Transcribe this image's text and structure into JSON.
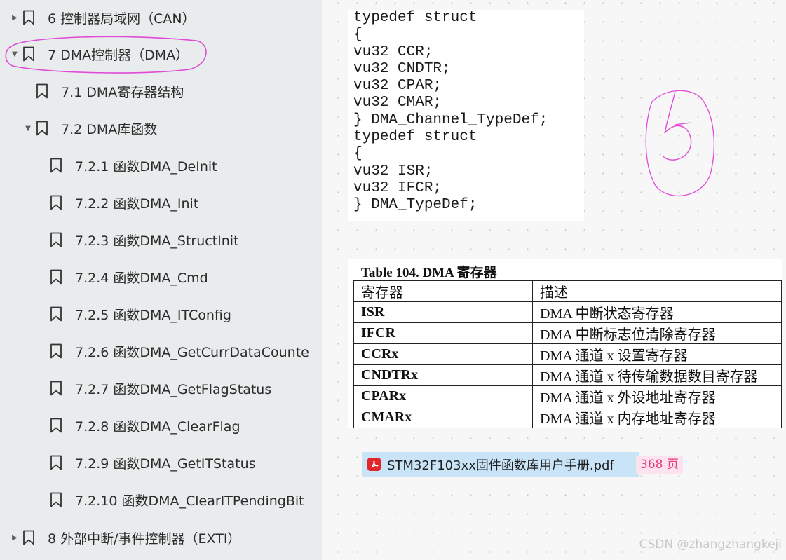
{
  "sidebar": {
    "items": [
      {
        "label": "6 控制器局域网（CAN）",
        "toggle": "collapsed"
      },
      {
        "label": "7  DMA控制器（DMA）",
        "toggle": "expanded"
      },
      {
        "label": "7.1 DMA寄存器结构",
        "toggle": "none"
      },
      {
        "label": "7.2 DMA库函数",
        "toggle": "expanded"
      },
      {
        "label": "7.2.1 函数DMA_DeInit",
        "toggle": "none"
      },
      {
        "label": "7.2.2 函数DMA_Init",
        "toggle": "none"
      },
      {
        "label": "7.2.3 函数DMA_StructInit",
        "toggle": "none"
      },
      {
        "label": "7.2.4 函数DMA_Cmd",
        "toggle": "none"
      },
      {
        "label": "7.2.5 函数DMA_ITConfig",
        "toggle": "none"
      },
      {
        "label": "7.2.6 函数DMA_GetCurrDataCounte",
        "toggle": "none"
      },
      {
        "label": "7.2.7 函数DMA_GetFlagStatus",
        "toggle": "none"
      },
      {
        "label": "7.2.8 函数DMA_ClearFlag",
        "toggle": "none"
      },
      {
        "label": "7.2.9 函数DMA_GetITStatus",
        "toggle": "none"
      },
      {
        "label": "7.2.10 函数DMA_ClearITPendingBit",
        "toggle": "none"
      },
      {
        "label": "8 外部中断/事件控制器（EXTI）",
        "toggle": "collapsed"
      }
    ],
    "bookmark_icon": "bookmark-icon",
    "highlight_color": "#e04ad6"
  },
  "code": {
    "lines": [
      "typedef struct",
      "{",
      "vu32 CCR;",
      "vu32 CNDTR;",
      "vu32 CPAR;",
      "vu32 CMAR;",
      "} DMA_Channel_TypeDef;",
      "typedef struct",
      "{",
      "vu32 ISR;",
      "vu32 IFCR;",
      "} DMA_TypeDef;"
    ]
  },
  "register_table": {
    "title": "Table 104. DMA 寄存器",
    "headers": [
      "寄存器",
      "描述"
    ],
    "rows": [
      [
        "ISR",
        "DMA 中断状态寄存器"
      ],
      [
        "IFCR",
        "DMA 中断标志位清除寄存器"
      ],
      [
        "CCRx",
        "DMA 通道 x 设置寄存器"
      ],
      [
        "CNDTRx",
        "DMA 通道 x 待传输数据数目寄存器"
      ],
      [
        "CPARx",
        "DMA 通道 x 外设地址寄存器"
      ],
      [
        "CMARx",
        "DMA 通道 x 内存地址寄存器"
      ]
    ]
  },
  "pdf_ref": {
    "file_name": "STM32F103xx固件函数库用户手册.pdf",
    "page": "368 页",
    "icon": "pdf-file-icon"
  },
  "annotation": {
    "handwritten_mark": "5"
  },
  "watermark": "CSDN @zhangzhangkeji"
}
